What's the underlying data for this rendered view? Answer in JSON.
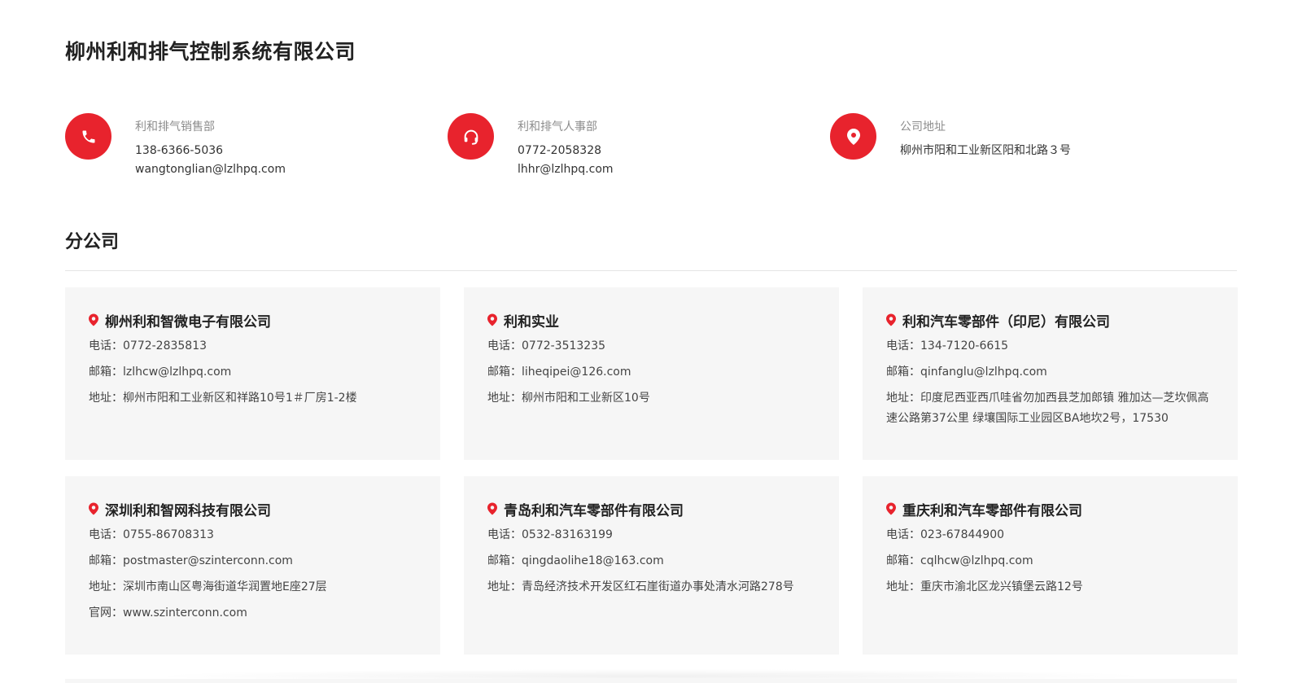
{
  "company": {
    "title": "柳州利和排气控制系统有限公司"
  },
  "contacts": [
    {
      "icon": "phone-icon",
      "label": "利和排气销售部",
      "lines": [
        "138-6366-5036",
        "wangtonglian@lzlhpq.com"
      ]
    },
    {
      "icon": "headset-icon",
      "label": "利和排气人事部",
      "lines": [
        "0772-2058328",
        "lhhr@lzlhpq.com"
      ]
    },
    {
      "icon": "location-pin-icon",
      "label": "公司地址",
      "lines": [
        "柳州市阳和工业新区阳和北路３号"
      ]
    }
  ],
  "branches_section": {
    "title": "分公司"
  },
  "branches": [
    {
      "name": "柳州利和智微电子有限公司",
      "lines": [
        "电话：0772-2835813",
        "邮箱：lzlhcw@lzlhpq.com",
        "地址：柳州市阳和工业新区和祥路10号1＃厂房1-2楼"
      ]
    },
    {
      "name": "利和实业",
      "lines": [
        "电话：0772-3513235",
        "邮箱：liheqipei@126.com",
        "地址：柳州市阳和工业新区10号"
      ]
    },
    {
      "name": "利和汽车零部件（印尼）有限公司",
      "lines": [
        "电话：134-7120-6615",
        "邮箱：qinfanglu@lzlhpq.com",
        "地址：印度尼西亚西爪哇省勿加西县芝加郎镇 雅加达—芝坎佩高速公路第37公里 绿壤国际工业园区BA地坎2号，17530"
      ]
    },
    {
      "name": "深圳利和智网科技有限公司",
      "lines": [
        "电话：0755-86708313",
        "邮箱：postmaster@szinterconn.com",
        "地址：深圳市南山区粤海街道华润置地E座27层",
        "官网：www.szinterconn.com"
      ]
    },
    {
      "name": "青岛利和汽车零部件有限公司",
      "lines": [
        "电话：0532-83163199",
        "邮箱：qingdaolihe18@163.com",
        "地址：青岛经济技术开发区红石崖街道办事处清水河路278号"
      ]
    },
    {
      "name": "重庆利和汽车零部件有限公司",
      "lines": [
        "电话：023-67844900",
        "邮箱：cqlhcw@lzlhpq.com",
        "地址：重庆市渝北区龙兴镇堡云路12号"
      ]
    }
  ],
  "colors": {
    "accent": "#e8232d",
    "card_background": "#f6f6f6",
    "label_gray": "#8c8c8c"
  }
}
